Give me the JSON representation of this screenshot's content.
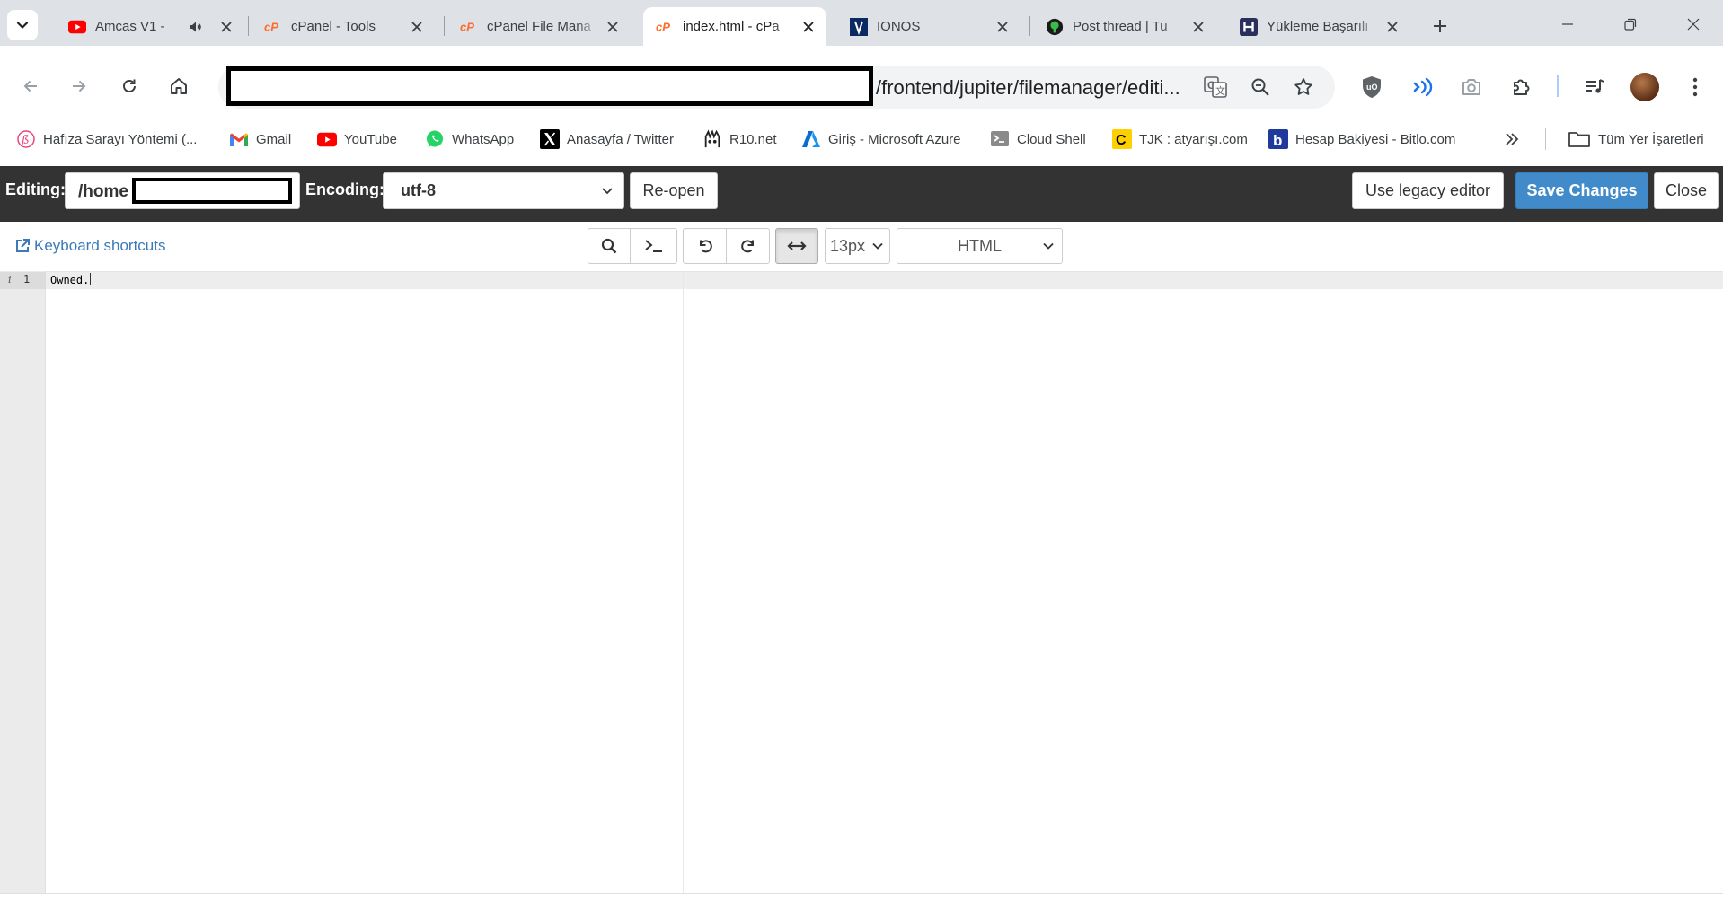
{
  "browser": {
    "tabs": [
      {
        "title": "Amcas V1 -",
        "favicon": "youtube-icon",
        "active": false,
        "audio": true
      },
      {
        "title": "cPanel - Tools",
        "favicon": "cpanel-icon",
        "active": false
      },
      {
        "title": "cPanel File Mana",
        "favicon": "cpanel-icon",
        "active": false
      },
      {
        "title": "index.html - cPa",
        "favicon": "cpanel-icon",
        "active": true
      },
      {
        "title": "IONOS",
        "favicon": "ionos-icon",
        "active": false
      },
      {
        "title": "Post thread | Tu",
        "favicon": "thread-icon",
        "active": false
      },
      {
        "title": "Yükleme Başarılı",
        "favicon": "h-icon",
        "active": false
      }
    ],
    "address": {
      "visible_url": "/frontend/jupiter/filemanager/editi..."
    },
    "bookmarks": [
      {
        "label": "Hafıza Sarayı Yöntemi (...",
        "icon": "hafiza-icon"
      },
      {
        "label": "Gmail",
        "icon": "gmail-icon"
      },
      {
        "label": "YouTube",
        "icon": "youtube-icon"
      },
      {
        "label": "WhatsApp",
        "icon": "whatsapp-icon"
      },
      {
        "label": "Anasayfa / Twitter",
        "icon": "x-icon"
      },
      {
        "label": "R10.net",
        "icon": "r10-icon"
      },
      {
        "label": "Giriş - Microsoft Azure",
        "icon": "azure-icon"
      },
      {
        "label": "Cloud Shell",
        "icon": "cloudshell-icon"
      },
      {
        "label": "TJK : atyarışı.com",
        "icon": "tjk-icon"
      },
      {
        "label": "Hesap Bakiyesi - Bitlo.com",
        "icon": "bitlo-icon"
      }
    ],
    "all_bookmarks_label": "Tüm Yer İşaretleri"
  },
  "editor_header": {
    "editing_label": "Editing:",
    "path_prefix": "/home",
    "encoding_label": "Encoding:",
    "encoding_value": "utf-8",
    "reopen_label": "Re-open",
    "legacy_label": "Use legacy editor",
    "save_label": "Save Changes",
    "close_label": "Close"
  },
  "editor_toolbar": {
    "keyboard_shortcuts": "Keyboard shortcuts",
    "font_size": "13px",
    "mode": "HTML",
    "wrap_pressed": true
  },
  "code": {
    "lines": [
      {
        "number": "1",
        "text": "Owned."
      }
    ]
  },
  "colors": {
    "primary_button": "#428bca",
    "editor_header_bg": "#333333",
    "link": "#3b7ab8"
  }
}
